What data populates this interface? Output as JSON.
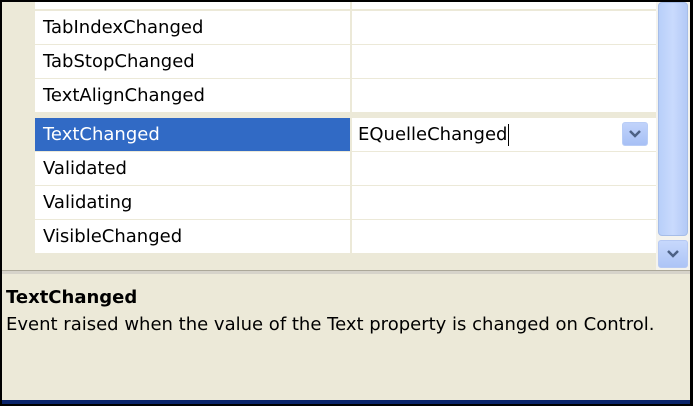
{
  "events": [
    {
      "name": "TabIndexChanged",
      "value": ""
    },
    {
      "name": "TabStopChanged",
      "value": ""
    },
    {
      "name": "TextAlignChanged",
      "value": ""
    },
    {
      "name": "TextChanged",
      "value": "EQuelleChanged"
    },
    {
      "name": "Validated",
      "value": ""
    },
    {
      "name": "Validating",
      "value": ""
    },
    {
      "name": "VisibleChanged",
      "value": ""
    }
  ],
  "selected_index": 3,
  "description": {
    "title": "TextChanged",
    "text": "Event raised when the value of the Text property is changed on Control."
  },
  "colors": {
    "selection": "#316ac5",
    "background": "#ece9d8",
    "scroll_accent": "#4d6185"
  },
  "icons": {
    "combo": "chevron-down-icon",
    "scroll_down": "chevron-down-icon"
  }
}
